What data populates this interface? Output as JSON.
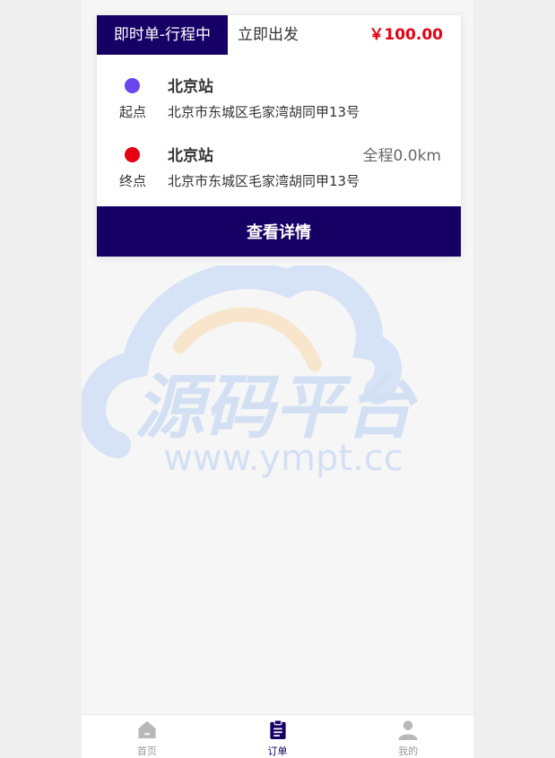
{
  "order": {
    "status_tag": "即时单-行程中",
    "depart_type": "立即出发",
    "price": "￥100.00",
    "start": {
      "station": "北京站",
      "label": "起点",
      "address": "北京市东城区毛家湾胡同甲13号"
    },
    "end": {
      "station": "北京站",
      "label": "终点",
      "address": "北京市东城区毛家湾胡同甲13号",
      "distance": "全程0.0km"
    },
    "detail_button": "查看详情"
  },
  "watermark": {
    "title": "源码平台",
    "url": "www.ympt.cc"
  },
  "tabbar": {
    "items": [
      {
        "label": "首页",
        "icon": "home-icon"
      },
      {
        "label": "订单",
        "icon": "clipboard-icon"
      },
      {
        "label": "我的",
        "icon": "user-icon"
      }
    ]
  },
  "colors": {
    "brand": "#160066",
    "price": "#e60012",
    "start_dot": "#6a46ee",
    "end_dot": "#e60012"
  }
}
